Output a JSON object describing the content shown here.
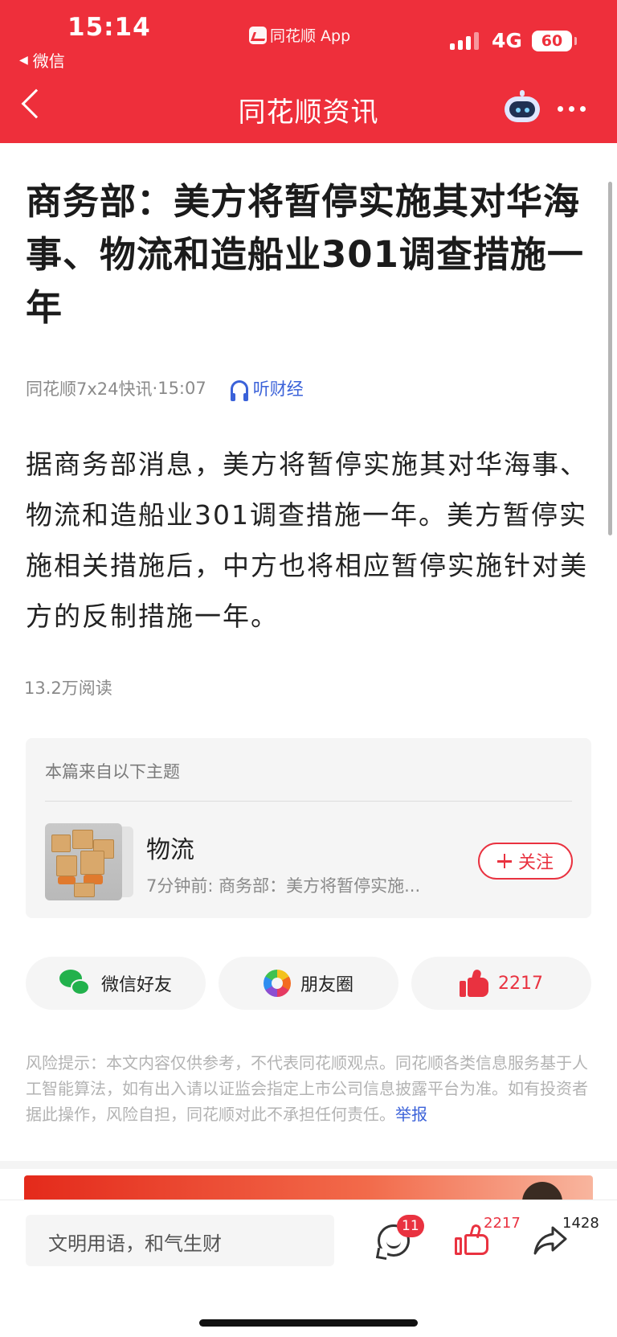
{
  "status_bar": {
    "time": "15:14",
    "back_app": "微信",
    "app_label": "同花顺 App",
    "network": "4G",
    "battery": "60"
  },
  "nav": {
    "title": "同花顺资讯",
    "back_icon": "chevron-left-icon",
    "assistant_icon": "robot-icon",
    "more_icon": "more-dots-icon"
  },
  "article": {
    "headline": "商务部：美方将暂停实施其对华海事、物流和造船业301调查措施一年",
    "source": "同花顺7x24快讯",
    "time": "15:07",
    "listen_label": "听财经",
    "body": "据商务部消息，美方将暂停实施其对华海事、物流和造船业301调查措施一年。美方暂停实施相关措施后，中方也将相应暂停实施针对美方的反制措施一年。",
    "reads": "13.2万阅读"
  },
  "topic": {
    "header": "本篇来自以下主题",
    "name": "物流",
    "latest": "7分钟前: 商务部：美方将暂停实施...",
    "follow_label": "关注"
  },
  "share": {
    "wechat_label": "微信好友",
    "moments_label": "朋友圈",
    "like_count": "2217"
  },
  "risk": {
    "text": "风险提示：本文内容仅供参考，不代表同花顺观点。同花顺各类信息服务基于人工智能算法，如有出入请以证监会指定上市公司信息披露平台为准。如有投资者据此操作，风险自担，同花顺对此不承担任何责任。",
    "report_label": "举报"
  },
  "bottom_bar": {
    "comment_placeholder": "文明用语，和气生财",
    "comment_count": "11",
    "like_count": "2217",
    "share_count": "1428"
  },
  "colors": {
    "brand_red": "#ee2f3b",
    "link_blue": "#3b62d9"
  }
}
